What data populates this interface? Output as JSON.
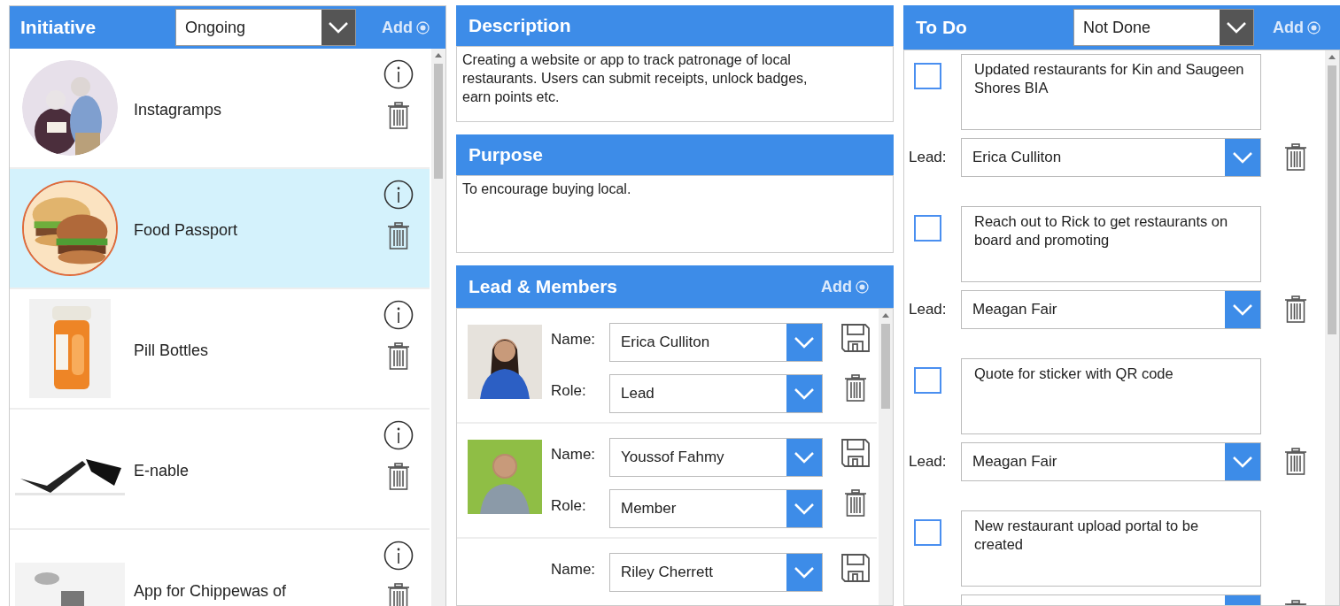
{
  "initiatives": {
    "title": "Initiative",
    "filter": "Ongoing",
    "add_label": "Add",
    "items": [
      {
        "name": "Instagramps",
        "selected": false,
        "kind": "people"
      },
      {
        "name": "Food Passport",
        "selected": true,
        "kind": "burger"
      },
      {
        "name": "Pill Bottles",
        "selected": false,
        "kind": "bottle"
      },
      {
        "name": "E-nable",
        "selected": false,
        "kind": "hand"
      },
      {
        "name": "App for Chippewas of",
        "selected": false,
        "kind": "machine"
      }
    ]
  },
  "description": {
    "title": "Description",
    "text": "Creating a website or app to track patronage of local restaurants. Users can submit receipts, unlock badges, earn points etc."
  },
  "purpose": {
    "title": "Purpose",
    "text": "To encourage buying local."
  },
  "members": {
    "title": "Lead & Members",
    "add_label": "Add",
    "items": [
      {
        "name_label": "Name:",
        "name": "Erica Culliton",
        "role_label": "Role:",
        "role": "Lead",
        "photo": true
      },
      {
        "name_label": "Name:",
        "name": "Youssof Fahmy",
        "role_label": "Role:",
        "role": "Member",
        "photo": true
      },
      {
        "name_label": "Name:",
        "name": "Riley Cherrett",
        "photo": false
      }
    ]
  },
  "todo": {
    "title": "To Do",
    "filter": "Not Done",
    "add_label": "Add",
    "items": [
      {
        "text": "Updated restaurants for Kin and Saugeen Shores BIA",
        "checked": false,
        "lead_label": "Lead:",
        "lead": "Erica Culliton"
      },
      {
        "text": "Reach out to Rick to get restaurants on board and promoting",
        "checked": false,
        "lead_label": "Lead:",
        "lead": "Meagan Fair"
      },
      {
        "text": "Quote for sticker with QR code",
        "checked": false,
        "lead_label": "Lead:",
        "lead": "Meagan Fair"
      },
      {
        "text": "New restaurant upload portal to be created",
        "checked": false
      }
    ]
  }
}
